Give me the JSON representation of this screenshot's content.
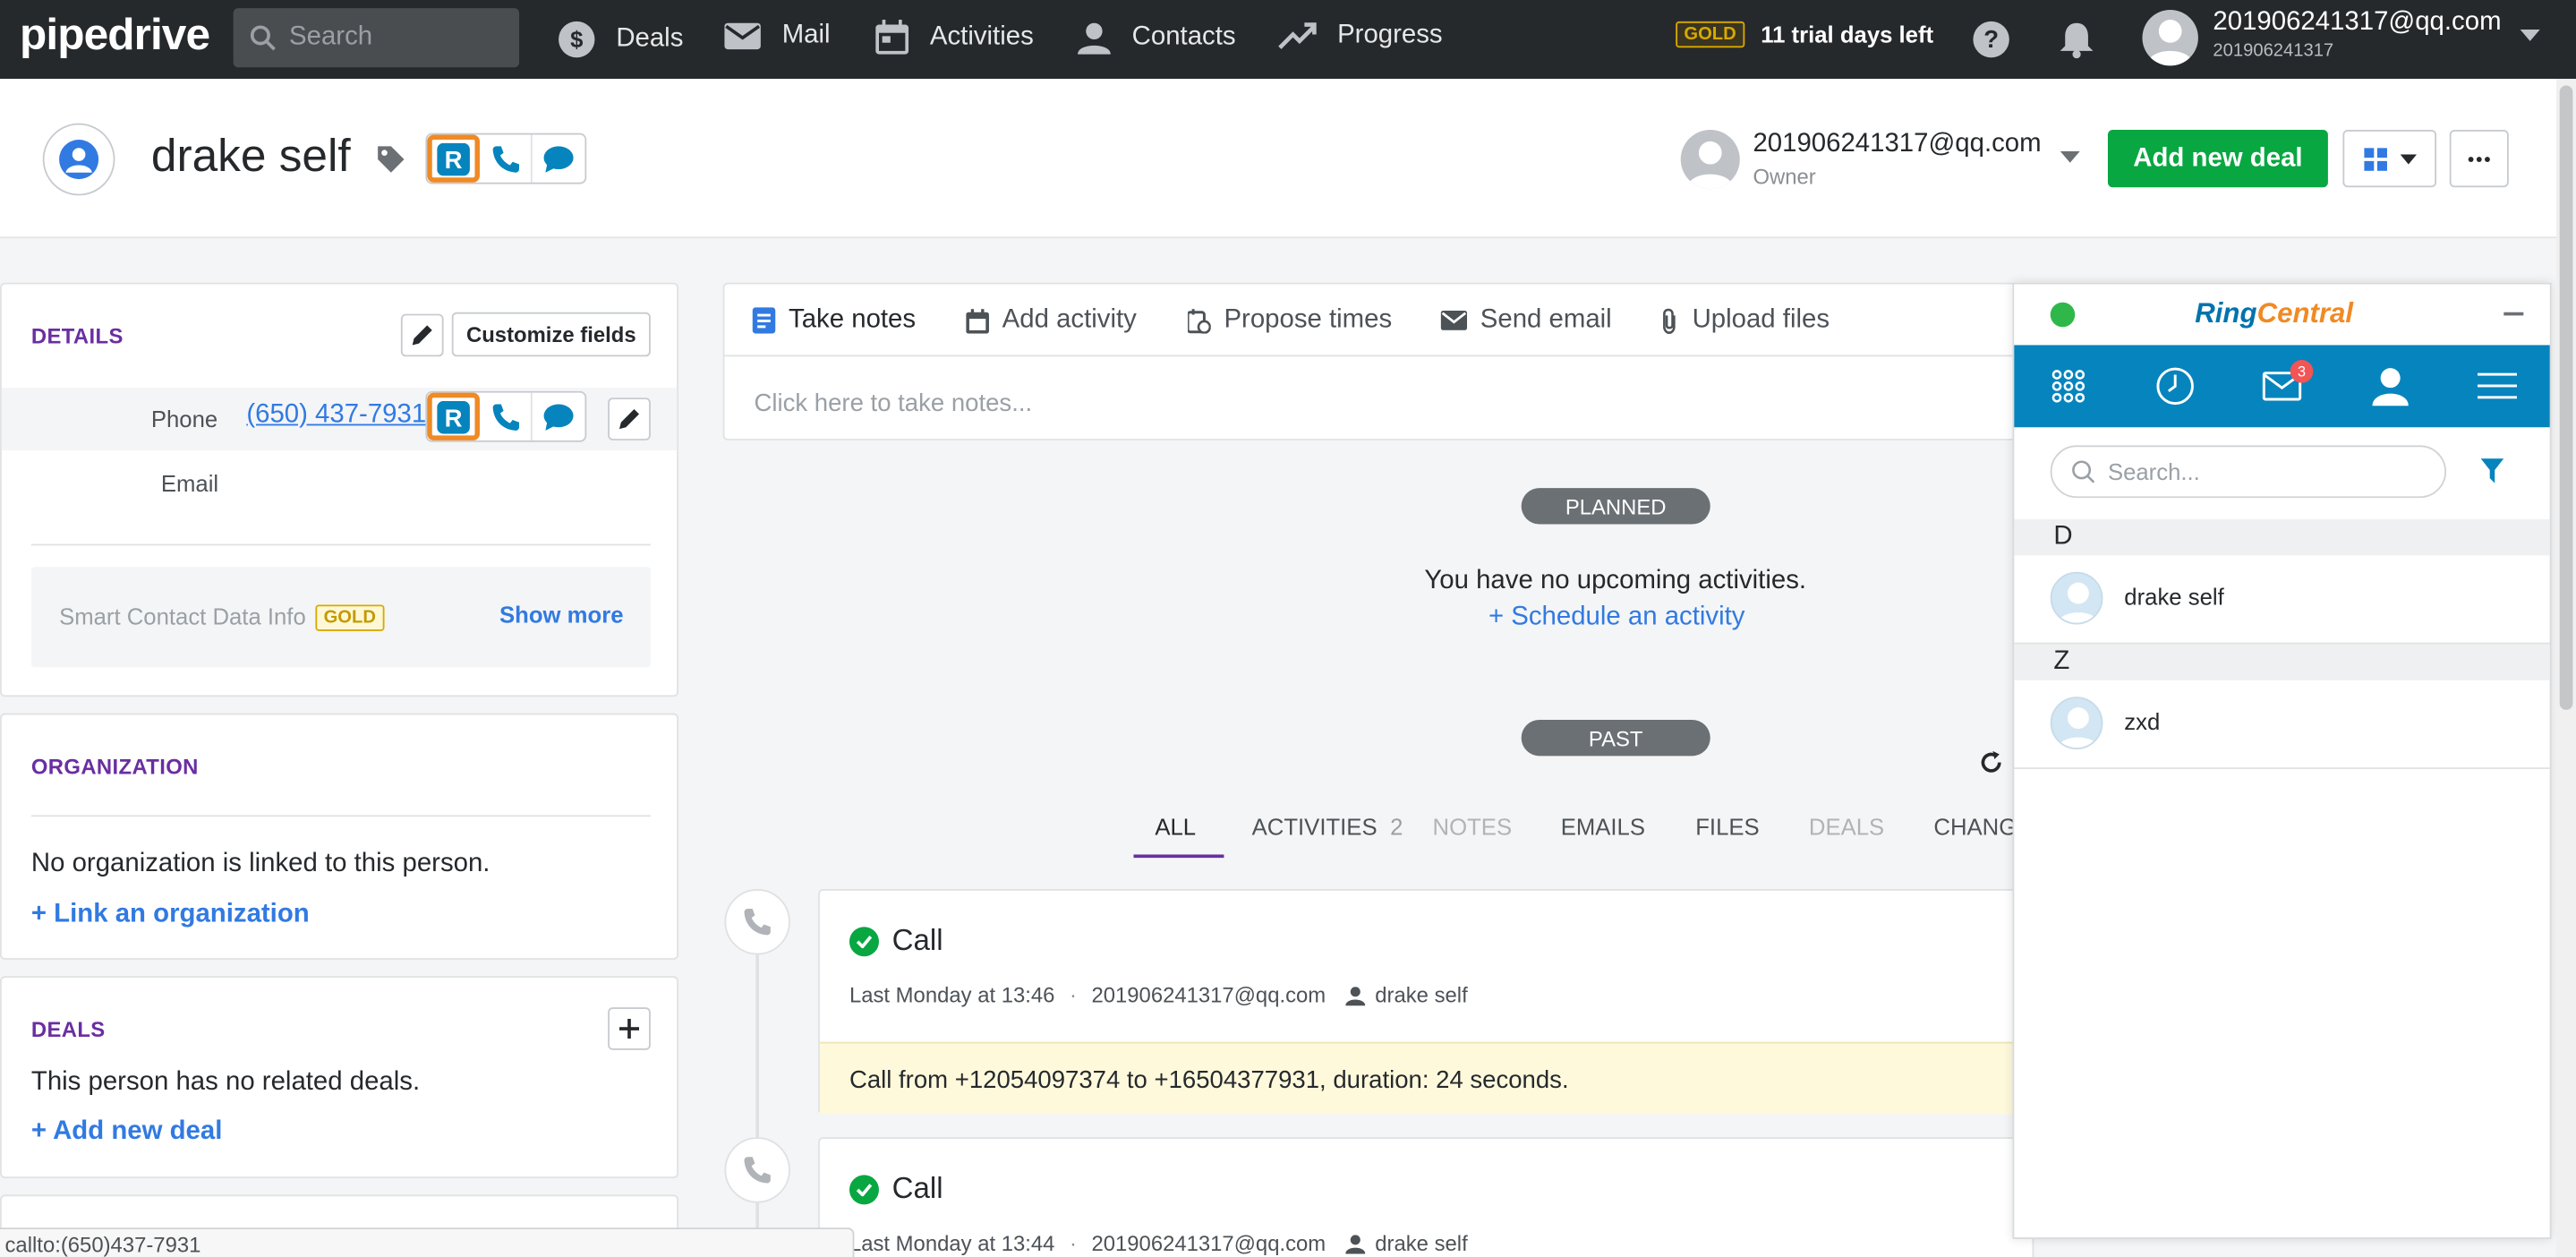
{
  "topbar": {
    "logo": "pipedrive",
    "search_placeholder": "Search",
    "nav": [
      {
        "label": "Deals",
        "icon": "dollar-icon"
      },
      {
        "label": "Mail",
        "icon": "mail-icon"
      },
      {
        "label": "Activities",
        "icon": "calendar-icon"
      },
      {
        "label": "Contacts",
        "icon": "person-icon"
      },
      {
        "label": "Progress",
        "icon": "trend-icon"
      }
    ],
    "gold_badge": "GOLD",
    "trial_text": "11 trial days left",
    "user_email": "201906241317@qq.com",
    "user_id": "201906241317"
  },
  "header": {
    "person_name": "drake self",
    "owner_email": "201906241317@qq.com",
    "owner_label": "Owner",
    "add_deal_label": "Add new deal"
  },
  "details": {
    "title": "DETAILS",
    "customize_label": "Customize fields",
    "phone_label": "Phone",
    "phone_value": "(650) 437-7931",
    "email_label": "Email",
    "smart_text": "Smart Contact Data Info",
    "smart_badge": "GOLD",
    "show_more": "Show more"
  },
  "organization": {
    "title": "ORGANIZATION",
    "empty_text": "No organization is linked to this person.",
    "link_label": "+ Link an organization"
  },
  "deals": {
    "title": "DEALS",
    "empty_text": "This person has no related deals.",
    "add_label": "+ Add new deal"
  },
  "notes": {
    "tabs": [
      {
        "label": "Take notes",
        "icon": "note-icon"
      },
      {
        "label": "Add activity",
        "icon": "calendar-icon"
      },
      {
        "label": "Propose times",
        "icon": "clock-calendar-icon"
      },
      {
        "label": "Send email",
        "icon": "mail-icon"
      },
      {
        "label": "Upload files",
        "icon": "paperclip-icon"
      }
    ],
    "placeholder": "Click here to take notes..."
  },
  "timeline": {
    "planned_label": "PLANNED",
    "no_upcoming": "You have no upcoming activities.",
    "schedule_link": "+ Schedule an activity",
    "past_label": "PAST",
    "filters": [
      "ALL",
      "ACTIVITIES",
      "NOTES",
      "EMAILS",
      "FILES",
      "DEALS",
      "CHANGE"
    ],
    "activities_count": "2",
    "activities": [
      {
        "title": "Call",
        "time": "Last Monday at 13:46",
        "user": "201906241317@qq.com",
        "person": "drake self",
        "note": "Call from +12054097374 to +16504377931, duration: 24 seconds."
      },
      {
        "title": "Call",
        "time": "Last Monday at 13:44",
        "user": "201906241317@qq.com",
        "person": "drake self"
      }
    ]
  },
  "statusbar": {
    "text": "callto:(650)437-7931"
  },
  "ringcentral": {
    "logo": "RingCentral",
    "unread_badge": "3",
    "search_placeholder": "Search...",
    "groups": [
      {
        "letter": "D",
        "contacts": [
          "drake self"
        ]
      },
      {
        "letter": "Z",
        "contacts": [
          "zxd"
        ]
      }
    ]
  },
  "colors": {
    "topbar": "#26292c",
    "accent_green": "#08a742",
    "link_blue": "#317ae2",
    "section_purple": "#6a2ea1",
    "ringcentral_blue": "#0684bd",
    "ringcentral_orange": "#f08a24"
  }
}
